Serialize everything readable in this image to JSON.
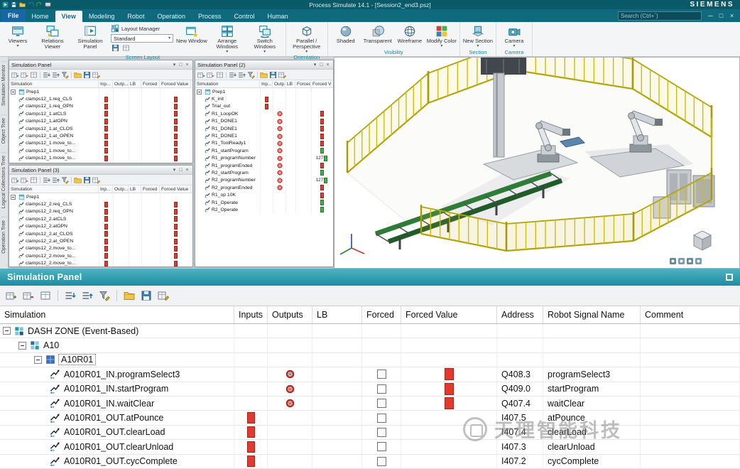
{
  "window": {
    "title": "Process Simulate 14.1 - [Session2_end3.psz]",
    "brand": "SIEMENS",
    "search_placeholder": "Search (Ctrl+`)"
  },
  "quick_access_icons": [
    "app-icon",
    "save-icon",
    "open-file-icon",
    "undo-icon",
    "redo-icon",
    "screenshot-icon"
  ],
  "tabs": [
    "File",
    "Home",
    "View",
    "Modeling",
    "Robot",
    "Operation",
    "Process",
    "Control",
    "Human"
  ],
  "active_tab": "View",
  "window_controls": [
    "minimize",
    "maximize",
    "close"
  ],
  "ribbon": {
    "groups": [
      {
        "label": "Screen Layout",
        "buttons": [
          {
            "label": "Viewers",
            "icon": "viewers-icon",
            "dropdown": true
          },
          {
            "label": "Relations Viewer",
            "icon": "relations-viewer-icon"
          },
          {
            "label": "Simulation Panel",
            "icon": "simulation-panel-icon"
          },
          {
            "label": "Layout Manager",
            "icon": "layout-manager-icon",
            "combo_value": "Standard"
          },
          {
            "label": "New Window",
            "icon": "new-window-icon"
          },
          {
            "label": "Arrange Windows",
            "icon": "arrange-windows-icon",
            "dropdown": true
          },
          {
            "label": "Switch Windows",
            "icon": "switch-windows-icon",
            "dropdown": true
          }
        ]
      },
      {
        "label": "Orientation",
        "buttons": [
          {
            "label": "Parallel / Perspective",
            "icon": "perspective-icon",
            "dropdown": true
          }
        ]
      },
      {
        "label": "Visibility",
        "buttons": [
          {
            "label": "Shaded",
            "icon": "shaded-icon"
          },
          {
            "label": "Transparent",
            "icon": "transparent-icon"
          },
          {
            "label": "Wireframe",
            "icon": "wireframe-icon"
          },
          {
            "label": "Modify Color",
            "icon": "modify-color-icon",
            "dropdown": true
          }
        ]
      },
      {
        "label": "Section",
        "buttons": [
          {
            "label": "New Section",
            "icon": "new-section-icon",
            "dropdown": true
          }
        ]
      },
      {
        "label": "Camera",
        "buttons": [
          {
            "label": "Camera",
            "icon": "camera-icon",
            "dropdown": true
          }
        ]
      }
    ]
  },
  "side_tabs": [
    "Simulation Monitor",
    "Object Tree",
    "Logical Collections Tree",
    "Operation Tree"
  ],
  "mini_columns": [
    "Simulation",
    "Inp...",
    "Outp...",
    "LB",
    "Forced",
    "Forced Value"
  ],
  "panel_toolbar_icons": [
    "attach-signals-icon",
    "detach-signals-icon",
    "clear-grid-icon",
    "expand-all-icon",
    "collapse-all-icon",
    "filter-edit-icon",
    "open-file-icon",
    "save-icon",
    "customize-columns-icon"
  ],
  "panels": [
    {
      "title": "Simulation Panel",
      "root": "Prep1",
      "rows": [
        {
          "label": "clamps12_1.req_CLS",
          "inp": "red",
          "fv": "red"
        },
        {
          "label": "clamps12_1.req_OPN",
          "inp": "red",
          "fv": "red"
        },
        {
          "label": "clamps12_1.atCLS",
          "inp": "red",
          "fv": "red"
        },
        {
          "label": "clamps12_1.atOPN",
          "inp": "red",
          "fv": "red"
        },
        {
          "label": "clamps12_1.at_CLOS",
          "inp": "red",
          "fv": "red"
        },
        {
          "label": "clamps12_1.at_OPEN",
          "inp": "red",
          "fv": "red"
        },
        {
          "label": "clamps12_1.move_to...",
          "inp": "red",
          "fv": "red"
        },
        {
          "label": "clamps12_1.move_to...",
          "inp": "red",
          "fv": "red"
        },
        {
          "label": "clamps12_1.move_to...",
          "inp": "red",
          "fv": "red"
        }
      ]
    },
    {
      "title": "Simulation Panel (3)",
      "root": "Prep1",
      "rows": [
        {
          "label": "clamps12_2.req_CLS",
          "inp": "red",
          "fv": "red"
        },
        {
          "label": "clamps12_2.req_OPN",
          "inp": "red",
          "fv": "red"
        },
        {
          "label": "clamps12_2.atCLS",
          "inp": "red",
          "fv": "red"
        },
        {
          "label": "clamps12_2.atOPN",
          "inp": "red",
          "fv": "red"
        },
        {
          "label": "clamps12_2.at_CLOS",
          "inp": "red",
          "fv": "red"
        },
        {
          "label": "clamps12_2.at_OPEN",
          "inp": "red",
          "fv": "red"
        },
        {
          "label": "clamps12_2.move_to...",
          "inp": "red",
          "fv": "red"
        },
        {
          "label": "clamps12_2.move_to...",
          "inp": "red",
          "fv": "red"
        },
        {
          "label": "clamps12_2.move_to...",
          "inp": "red",
          "fv": "red"
        }
      ]
    },
    {
      "title": "Simulation Panel (2)",
      "root": "Prep1",
      "rows": [
        {
          "label": "K_init",
          "inp": "red"
        },
        {
          "label": "Trial_out",
          "inp": "red"
        },
        {
          "label": "R1_LoopOK",
          "outp": "dot",
          "fv": "red"
        },
        {
          "label": "R1_DONE1",
          "outp": "dot",
          "fv": "red"
        },
        {
          "label": "R1_DONE1",
          "outp": "dot",
          "fv": "red"
        },
        {
          "label": "R1_DONE1",
          "outp": "dot",
          "fv": "red"
        },
        {
          "label": "R1_ToolReady1",
          "outp": "dot",
          "fv": "red"
        },
        {
          "label": "R1_startProgram",
          "outp": "dot",
          "fv": "green"
        },
        {
          "label": "R1_programNumber",
          "outp": "dot",
          "value": "127",
          "fv": "green"
        },
        {
          "label": "R1_programEnded",
          "outp": "dot",
          "fv": "red"
        },
        {
          "label": "R2_startProgram",
          "outp": "dot",
          "fv": "green"
        },
        {
          "label": "R2_programNumber",
          "outp": "dot",
          "value": "127",
          "fv": "green"
        },
        {
          "label": "R2_programEnded",
          "outp": "dot",
          "fv": "red"
        },
        {
          "label": "R1_op 10K",
          "fv": "red"
        },
        {
          "label": "R1_Operate",
          "fv": "green"
        },
        {
          "label": "R2_Operate",
          "fv": "green"
        }
      ]
    }
  ],
  "bottom_panel": {
    "title": "Simulation Panel",
    "columns": [
      "Simulation",
      "Inputs",
      "Outputs",
      "LB",
      "Forced",
      "Forced Value",
      "Address",
      "Robot Signal Name",
      "Comment"
    ],
    "rows": [
      {
        "type": "group",
        "level": 0,
        "label": "DASH ZONE (Event-Based)",
        "icon": "zone-icon",
        "expanded": true
      },
      {
        "type": "group",
        "level": 1,
        "label": "A10",
        "icon": "station-icon",
        "expanded": true
      },
      {
        "type": "group",
        "level": 2,
        "label": "A10R01",
        "icon": "robot-icon",
        "expanded": true,
        "selected": true
      },
      {
        "type": "signal",
        "level": 3,
        "label": "A010R01_IN.programSelect3",
        "outputs": "dot",
        "forced": "checkbox",
        "forced_value": "red",
        "address": "Q408.3",
        "signal_name": "programSelect3",
        "comment": ""
      },
      {
        "type": "signal",
        "level": 3,
        "label": "A010R01_IN.startProgram",
        "outputs": "dot",
        "forced": "checkbox",
        "forced_value": "red",
        "address": "Q409.0",
        "signal_name": "startProgram",
        "comment": ""
      },
      {
        "type": "signal",
        "level": 3,
        "label": "A010R01_IN.waitClear",
        "outputs": "dot",
        "forced": "checkbox",
        "forced_value": "red",
        "address": "Q407.4",
        "signal_name": "waitClear",
        "comment": ""
      },
      {
        "type": "signal",
        "level": 3,
        "label": "A010R01_OUT.atPounce",
        "inputs": "block",
        "forced": "checkbox",
        "address": "I407.5",
        "signal_name": "atPounce",
        "comment": ""
      },
      {
        "type": "signal",
        "level": 3,
        "label": "A010R01_OUT.clearLoad",
        "inputs": "block",
        "forced": "checkbox",
        "address": "I407.4",
        "signal_name": "clearLoad",
        "comment": ""
      },
      {
        "type": "signal",
        "level": 3,
        "label": "A010R01_OUT.clearUnload",
        "inputs": "block",
        "forced": "checkbox",
        "address": "I407.3",
        "signal_name": "clearUnload",
        "comment": ""
      },
      {
        "type": "signal",
        "level": 3,
        "label": "A010R01_OUT.cycComplete",
        "inputs": "block",
        "forced": "checkbox",
        "address": "I407.2",
        "signal_name": "cycComplete",
        "comment": ""
      }
    ]
  },
  "viewport_icons": [
    "axis-triad-icon",
    "view-cube-icon",
    "view-toolbar-icons"
  ],
  "watermark": {
    "text": "天理智能科技"
  },
  "colors": {
    "accent_teal": "#1d8da1",
    "titlebar_teal": "#0a5968",
    "signal_red": "#e23a2e",
    "signal_green": "#43b049",
    "fence_yellow": "#c9b916"
  }
}
